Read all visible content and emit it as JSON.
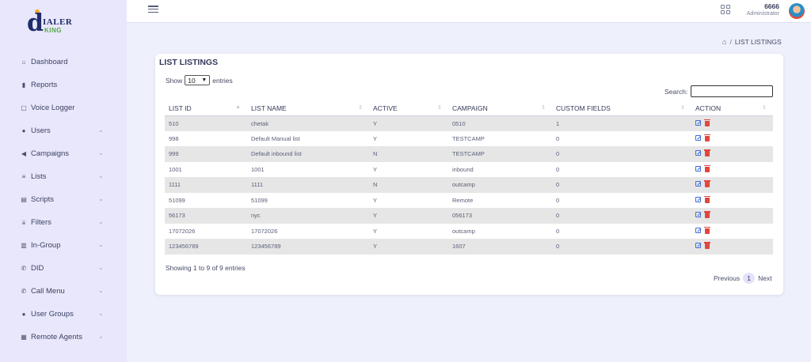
{
  "brand": {
    "logo_main": "IALER",
    "logo_sub": "KING"
  },
  "sidebar": {
    "items": [
      {
        "label": "Dashboard",
        "icon": "home-icon",
        "chevron": false
      },
      {
        "label": "Reports",
        "icon": "bar-chart-icon",
        "chevron": false
      },
      {
        "label": "Voice Logger",
        "icon": "document-icon",
        "chevron": false
      },
      {
        "label": "Users",
        "icon": "user-icon",
        "chevron": true
      },
      {
        "label": "Campaigns",
        "icon": "megaphone-icon",
        "chevron": true
      },
      {
        "label": "Lists",
        "icon": "list-icon",
        "chevron": true
      },
      {
        "label": "Scripts",
        "icon": "script-icon",
        "chevron": true
      },
      {
        "label": "Filters",
        "icon": "filter-icon",
        "chevron": true
      },
      {
        "label": "In-Group",
        "icon": "columns-icon",
        "chevron": true
      },
      {
        "label": "DID",
        "icon": "phone-icon",
        "chevron": true
      },
      {
        "label": "Call Menu",
        "icon": "phone-forward-icon",
        "chevron": true
      },
      {
        "label": "User Groups",
        "icon": "users-icon",
        "chevron": true
      },
      {
        "label": "Remote Agents",
        "icon": "grid-icon",
        "chevron": true
      }
    ]
  },
  "header": {
    "user_name": "6666",
    "user_role": "Administrator"
  },
  "breadcrumb": {
    "current": "LIST LISTINGS"
  },
  "card": {
    "title": "LIST LISTINGS",
    "show_label": "Show",
    "entries_value": "10",
    "entries_label": "entries",
    "search_label": "Search:",
    "search_value": "",
    "info": "Showing 1 to 9 of 9 entries",
    "prev_label": "Previous",
    "page": "1",
    "next_label": "Next"
  },
  "table": {
    "columns": [
      "LIST ID",
      "LIST NAME",
      "ACTIVE",
      "CAMPAIGN",
      "CUSTOM FIELDS",
      "ACTION"
    ],
    "rows": [
      [
        "510",
        "chetak",
        "Y",
        "0510",
        "1"
      ],
      [
        "998",
        "Default Manual list",
        "Y",
        "TESTCAMP",
        "0"
      ],
      [
        "999",
        "Default inbound list",
        "N",
        "TESTCAMP",
        "0"
      ],
      [
        "1001",
        "1001",
        "Y",
        "inbound",
        "0"
      ],
      [
        "1111",
        "1111",
        "N",
        "outcamp",
        "0"
      ],
      [
        "51099",
        "51099",
        "Y",
        "Remote",
        "0"
      ],
      [
        "56173",
        "nyc",
        "Y",
        "056173",
        "0"
      ],
      [
        "17072026",
        "17072026",
        "Y",
        "outcamp",
        "0"
      ],
      [
        "123456789",
        "123456789",
        "Y",
        "1607",
        "0"
      ]
    ]
  },
  "colors": {
    "sidebar_bg": "#e9e7fb",
    "page_bg": "#eef0fb",
    "edit": "#3d6fd8",
    "delete": "#e0473e"
  }
}
